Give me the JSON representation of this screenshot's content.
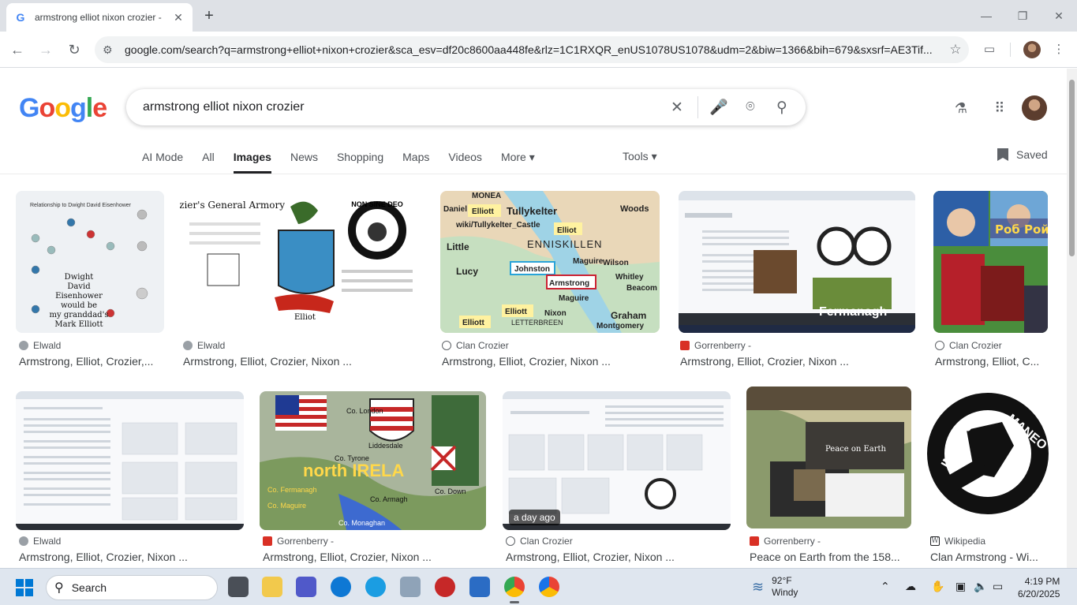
{
  "browser": {
    "tab_title": "armstrong elliot nixon crozier -",
    "url": "google.com/search?q=armstrong+elliot+nixon+crozier&sca_esv=df20c8600aa448fe&rlz=1C1RXQR_enUS1078US1078&udm=2&biw=1366&bih=679&sxsrf=AE3Tif..."
  },
  "google": {
    "logo": [
      "G",
      "o",
      "o",
      "g",
      "l",
      "e"
    ],
    "query": "armstrong elliot nixon crozier"
  },
  "nav": {
    "tabs": [
      "AI Mode",
      "All",
      "Images",
      "News",
      "Shopping",
      "Maps",
      "Videos",
      "More ▾"
    ],
    "tools": "Tools ▾",
    "saved": "Saved"
  },
  "results": [
    {
      "source": "Elwald",
      "title": "Armstrong, Elliot, Crozier,...",
      "fav": "#9aa0a6",
      "thumb_text": [
        "Relationship to Dwight David Eisenhower",
        "Dwight David Eisenhower would be my granddad's Mark Elliott sixth cousin."
      ]
    },
    {
      "source": "Elwald",
      "title": "Armstrong, Elliot, Crozier, Nixon ...",
      "fav": "#9aa0a6",
      "thumb_text": [
        "Crozier's General Armory",
        "NON SINE DEO",
        "Elliot"
      ]
    },
    {
      "source": "Clan Crozier",
      "title": "Armstrong, Elliot, Crozier, Nixon ...",
      "fav": "#5f6368",
      "thumb_text": [
        "MONEA",
        "Elliott",
        "Tullykelter",
        "wiki/Tullykelter_Castle",
        "Woods",
        "Daniel",
        "Elliot",
        "Little",
        "ENNISKILLEN",
        "Johnston",
        "Maguire",
        "Wilson",
        "Lucy",
        "Armstrong",
        "Whitley",
        "Maguire",
        "Beacom",
        "Elliott",
        "Elliott",
        "Nixon",
        "Graham",
        "LETTERBREEN",
        "Montgomery"
      ]
    },
    {
      "source": "Gorrenberry -",
      "title": "Armstrong, Elliot, Crozier, Nixon ...",
      "fav": "#d93025",
      "thumb_text": [
        "Fermanagh"
      ]
    },
    {
      "source": "Clan Crozier",
      "title": "Armstrong, Elliot, C...",
      "fav": "#5f6368",
      "thumb_text": [
        "Роб Рой"
      ]
    },
    {
      "source": "Elwald",
      "title": "Armstrong, Elliot, Crozier, Nixon ...",
      "fav": "#9aa0a6",
      "thumb_text": []
    },
    {
      "source": "Gorrenberry -",
      "title": "Armstrong, Elliot, Crozier, Nixon ...",
      "fav": "#d93025",
      "thumb_text": [
        "Co. London",
        "Co. Tyrone",
        "Liddesdale",
        "north IRELA",
        "Co. Fermanagh",
        "Co. Armagh",
        "Co. Down",
        "Co. Maguire",
        "Co. Monaghan"
      ]
    },
    {
      "source": "Clan Crozier",
      "title": "Armstrong, Elliot, Crozier, Nixon ...",
      "fav": "#5f6368",
      "badge": "a day ago",
      "thumb_text": []
    },
    {
      "source": "Gorrenberry -",
      "title": "Peace on Earth from the 158...",
      "fav": "#d93025",
      "thumb_text": [
        "Peace on Earth"
      ]
    },
    {
      "source": "Wikipedia",
      "title": "Clan Armstrong - Wi...",
      "fav": "#202124",
      "thumb_text": [
        "INVICTUS",
        "MANEO"
      ]
    }
  ],
  "taskbar": {
    "search": "Search",
    "temp": "92°F",
    "condition": "Windy",
    "time": "4:19 PM",
    "date": "6/20/2025"
  },
  "colors": {
    "accent": "#1a73e8",
    "tabstrip": "#dee1e6"
  }
}
